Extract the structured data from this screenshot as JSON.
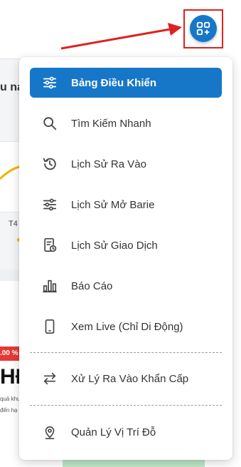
{
  "background": {
    "title_fragment": "u nạ",
    "axis_label": "T4",
    "badge_text": ".00 %",
    "big_text": "HĐ",
    "small_line_1": "quả khu",
    "small_line_2": "đến hạ"
  },
  "fab": {
    "icon": "apps-add-icon"
  },
  "menu": {
    "items": [
      {
        "label": "Bảng Điều Khiển",
        "icon": "sliders-icon",
        "active": true
      },
      {
        "label": "Tìm Kiếm Nhanh",
        "icon": "search-icon"
      },
      {
        "label": "Lịch Sử Ra Vào",
        "icon": "history-icon"
      },
      {
        "label": "Lịch Sử Mở Barie",
        "icon": "sliders-icon"
      },
      {
        "label": "Lịch Sử Giao Dịch",
        "icon": "receipt-clock-icon"
      },
      {
        "label": "Báo Cáo",
        "icon": "bar-chart-icon"
      },
      {
        "label": "Xem Live (Chỉ Di Động)",
        "icon": "phone-icon"
      },
      {
        "label": "Xử Lý Ra Vào Khẩn Cấp",
        "icon": "swap-arrows-icon"
      },
      {
        "label": "Quản Lý Vị Trí Đỗ",
        "icon": "location-pin-icon"
      }
    ]
  },
  "colors": {
    "primary": "#1677c9",
    "annotation_red": "#e02020",
    "text": "#333333",
    "icon": "#444444"
  }
}
